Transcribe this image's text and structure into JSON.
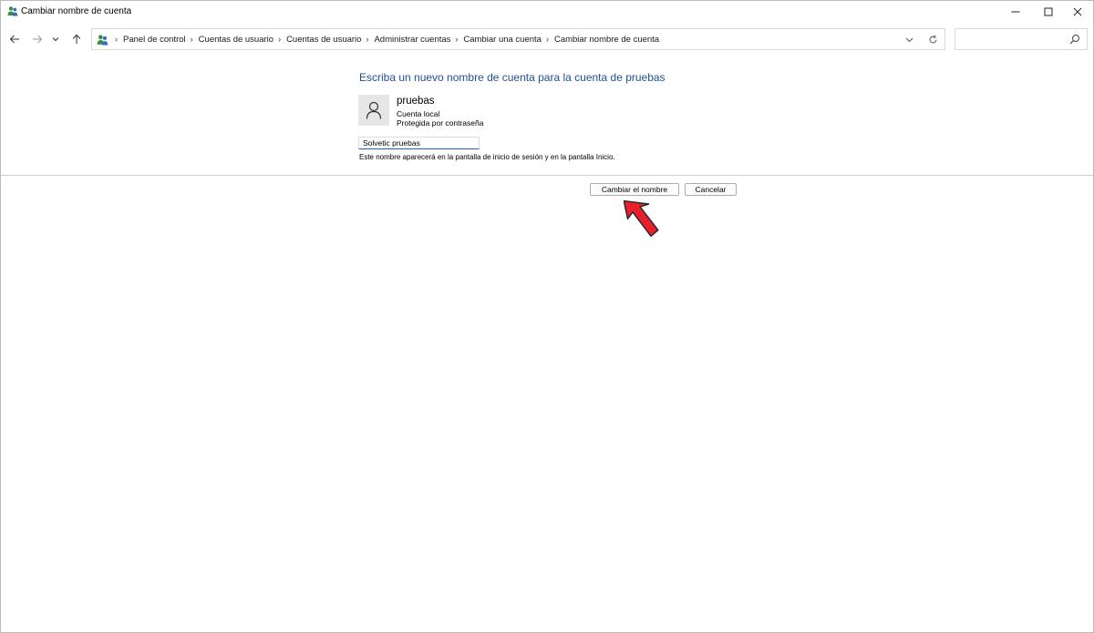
{
  "window": {
    "title": "Cambiar nombre de cuenta"
  },
  "address_bar": {
    "breadcrumbs": [
      "Panel de control",
      "Cuentas de usuario",
      "Cuentas de usuario",
      "Administrar cuentas",
      "Cambiar una cuenta",
      "Cambiar nombre de cuenta"
    ]
  },
  "search": {
    "placeholder": ""
  },
  "content": {
    "heading": "Escriba un nuevo nombre de cuenta para la cuenta de pruebas",
    "account": {
      "name": "pruebas",
      "type": "Cuenta local",
      "protection": "Protegida por contraseña"
    },
    "new_name_value": "Solvetic pruebas",
    "hint": "Este nombre aparecerá en la pantalla de inicio de sesión y en la pantalla Inicio."
  },
  "buttons": {
    "rename": "Cambiar el nombre",
    "cancel": "Cancelar"
  },
  "icons": {
    "app": "users-icon",
    "pointer": "red-pointer-icon"
  },
  "colors": {
    "heading": "#1e4f9a",
    "input_focus": "#1e62b8",
    "pointer": "#e8202a"
  }
}
